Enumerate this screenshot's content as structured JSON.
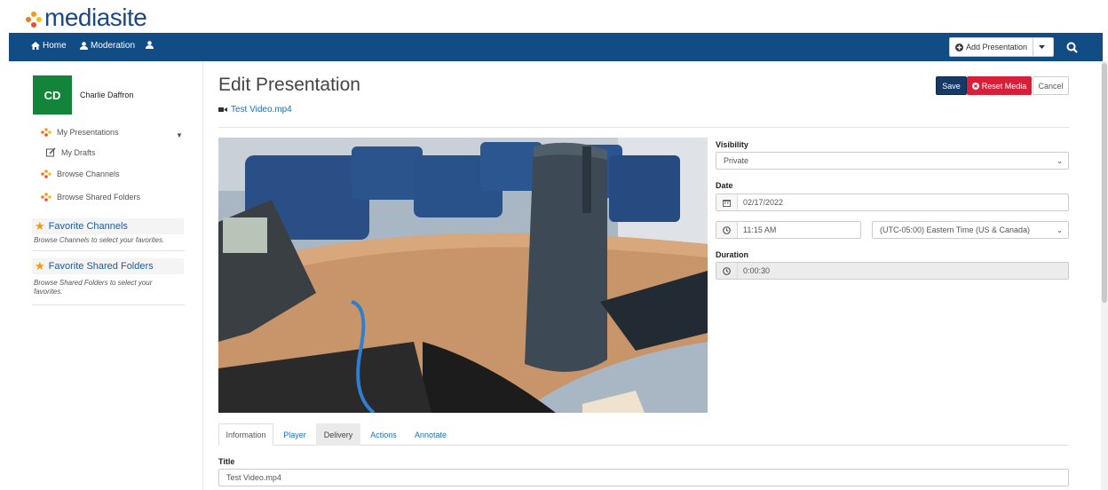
{
  "brand": {
    "logo_text": "mediasite"
  },
  "nav": {
    "home": "Home",
    "moderation": "Moderation",
    "add_presentation": "Add Presentation"
  },
  "sidebar": {
    "avatar_initials": "CD",
    "user_name": "Charlie Daffron",
    "links": [
      {
        "label": "My Presentations"
      },
      {
        "label": "My Drafts"
      },
      {
        "label": "Browse Channels"
      },
      {
        "label": "Browse Shared Folders"
      }
    ],
    "fav_channels": {
      "title": "Favorite Channels",
      "hint": "Browse Channels to select your favorites."
    },
    "fav_folders": {
      "title": "Favorite Shared Folders",
      "hint": "Browse Shared Folders to select your favorites."
    }
  },
  "main": {
    "page_title": "Edit Presentation",
    "file_name": "Test Video.mp4",
    "buttons": {
      "save": "Save",
      "reset": "Reset Media",
      "cancel": "Cancel"
    },
    "visibility": {
      "label": "Visibility",
      "value": "Private"
    },
    "date": {
      "label": "Date",
      "value": "02/17/2022",
      "time": "11:15 AM",
      "timezone": "(UTC-05:00) Eastern Time (US & Canada)"
    },
    "duration": {
      "label": "Duration",
      "value": "0:00:30"
    },
    "tabs": [
      {
        "label": "Information"
      },
      {
        "label": "Player"
      },
      {
        "label": "Delivery"
      },
      {
        "label": "Actions"
      },
      {
        "label": "Annotate"
      }
    ],
    "title_field": {
      "label": "Title",
      "value": "Test Video.mp4"
    }
  },
  "colors": {
    "nav": "#124c84",
    "brand": "#1a4a86",
    "save": "#153a66",
    "reset": "#d81f3a",
    "avatar": "#13843a",
    "link": "#1a6fb5"
  }
}
